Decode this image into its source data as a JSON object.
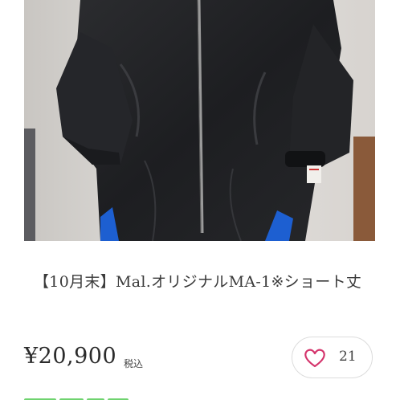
{
  "product": {
    "title": "【10月末】Mal.オリジナルMA-1※ショート丈",
    "price": "¥20,900",
    "tax_label": "税込",
    "like_count": "21"
  },
  "icons": {
    "like": "heart-outline-icon"
  },
  "colors": {
    "heart": "#d4336b",
    "text": "#3a3a3a"
  }
}
